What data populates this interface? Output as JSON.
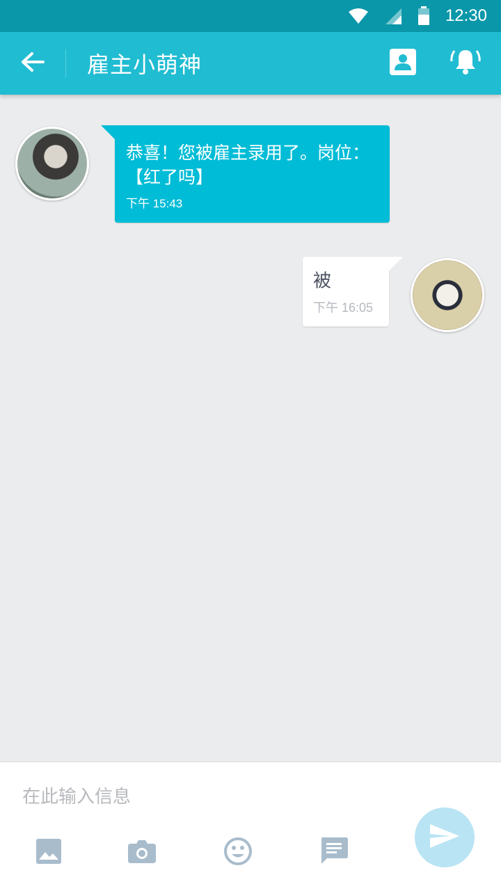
{
  "status_bar": {
    "time": "12:30",
    "icons": [
      "wifi-icon",
      "signal-icon",
      "battery-icon"
    ]
  },
  "header": {
    "title": "雇主小萌神",
    "back_icon": "arrow-back-icon",
    "actions": [
      "contact-card-icon",
      "bell-icon"
    ]
  },
  "messages": [
    {
      "direction": "incoming",
      "text": "恭喜！您被雇主录用了。岗位：【红了吗】",
      "time": "下午 15:43"
    },
    {
      "direction": "outgoing",
      "text": "被",
      "time": "下午 16:05"
    }
  ],
  "composer": {
    "placeholder": "在此输入信息",
    "tools": [
      "image-icon",
      "camera-icon",
      "emoji-icon",
      "quick-reply-icon"
    ],
    "send_icon": "send-icon"
  },
  "colors": {
    "status_bar": "#0a97a9",
    "app_bar": "#20bcd2",
    "incoming_bubble": "#00bcd6",
    "outgoing_bubble": "#ffffff",
    "background": "#ebecee",
    "tool_icon": "#a8bccc",
    "send_button": "#b9e4f4"
  }
}
